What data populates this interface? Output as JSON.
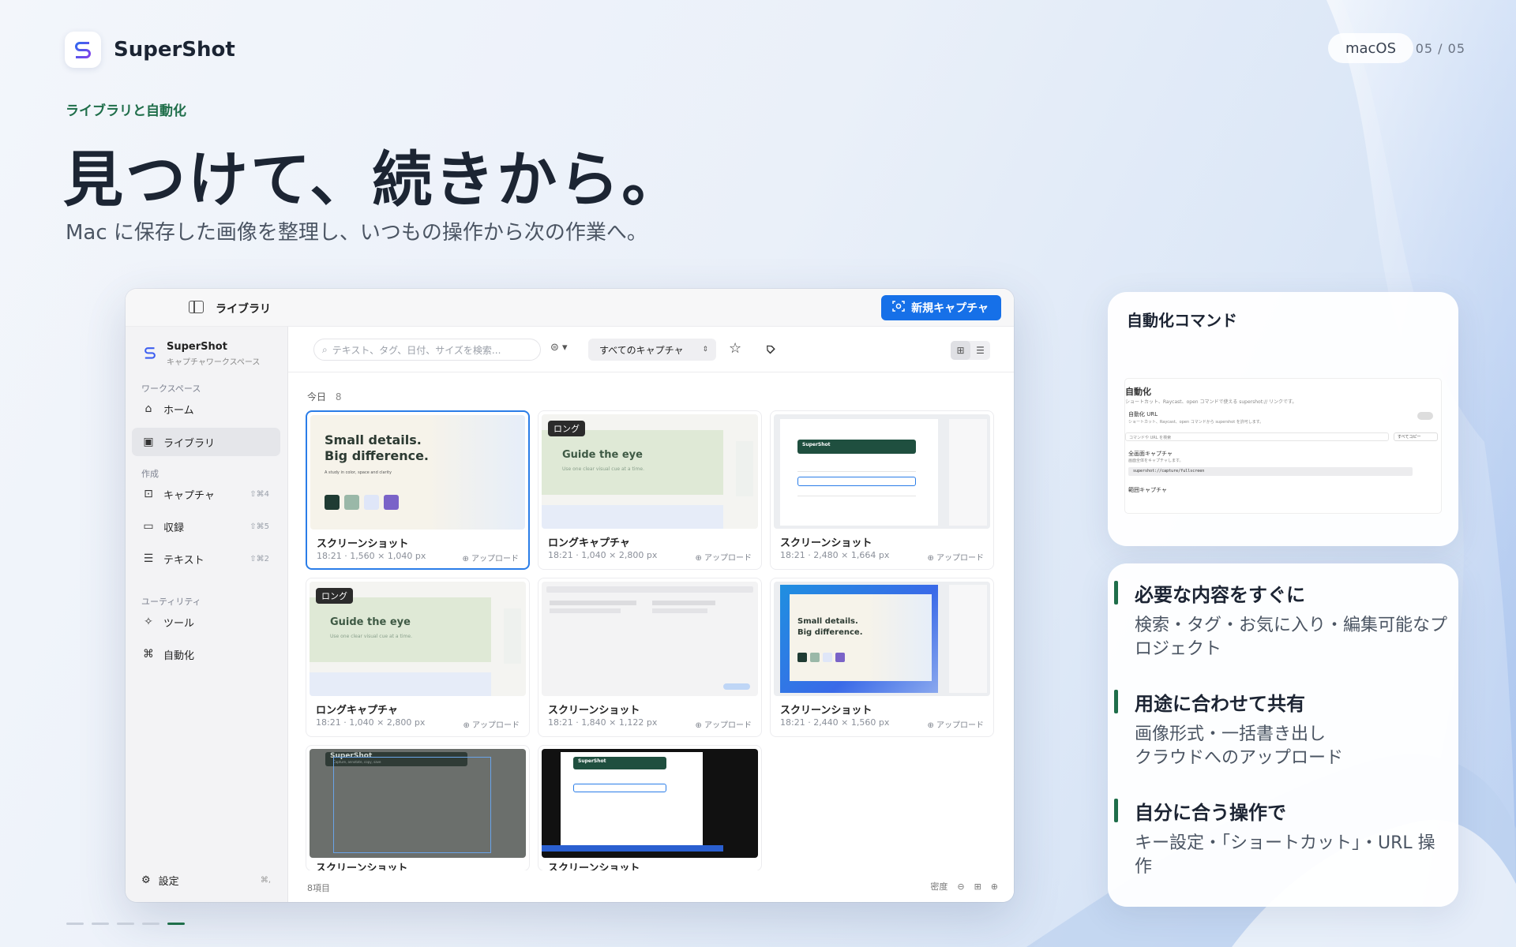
{
  "brand": {
    "name": "SuperShot"
  },
  "platform": "macOS",
  "pager": "05 / 05",
  "hero": {
    "eyebrow": "ライブラリと自動化",
    "headline": "見つけて、続きから。",
    "subline": "Mac に保存した画像を整理し、いつもの操作から次の作業へ。"
  },
  "window": {
    "title": "ライブラリ",
    "new_capture": "新規キャプチャ",
    "workspace": {
      "name": "SuperShot",
      "sub": "キャプチャワークスペース"
    },
    "sections": {
      "workspace": "ワークスペース",
      "create": "作成",
      "utility": "ユーティリティ"
    },
    "nav": {
      "home": "ホーム",
      "library": "ライブラリ",
      "capture": "キャプチャ",
      "capture_key": "⇧⌘4",
      "record": "収録",
      "record_key": "⇧⌘5",
      "text": "テキスト",
      "text_key": "⇧⌘2",
      "tools": "ツール",
      "automation": "自動化"
    },
    "settings": "設定",
    "settings_key": "⌘,",
    "search_placeholder": "テキスト、タグ、日付、サイズを検索...",
    "filter_select": "すべてのキャプチャ",
    "group_label": "今日",
    "group_count": "8",
    "item_count": "8項目",
    "density_label": "密度",
    "cards": [
      {
        "title": "スクリーンショット",
        "meta": "18:21 · 1,560 × 1,040 px",
        "upload": "アップロード",
        "thumb_text_1": "Small details.",
        "thumb_text_2": "Big difference.",
        "thumb_small": "A study in color, space and clarity"
      },
      {
        "title": "ロングキャプチャ",
        "meta": "18:21 · 1,040 × 2,800 px",
        "upload": "アップロード",
        "badge": "ロング",
        "thumb_text_1": "Guide the eye",
        "thumb_small": "Use one clear visual cue at a time."
      },
      {
        "title": "スクリーンショット",
        "meta": "18:21 · 2,480 × 1,664 px",
        "upload": "アップロード",
        "thumb_text_1": "SuperShot"
      },
      {
        "title": "ロングキャプチャ",
        "meta": "18:21 · 1,040 × 2,800 px",
        "upload": "アップロード",
        "badge": "ロング",
        "thumb_text_1": "Guide the eye",
        "thumb_small": "Use one clear visual cue at a time."
      },
      {
        "title": "スクリーンショット",
        "meta": "18:21 · 1,840 × 1,122 px",
        "upload": "アップロード"
      },
      {
        "title": "スクリーンショット",
        "meta": "18:21 · 2,440 × 1,560 px",
        "upload": "アップロード",
        "thumb_text_1": "Small details.",
        "thumb_text_2": "Big difference."
      },
      {
        "title": "スクリーンショット",
        "thumb_text_1": "SuperShot",
        "thumb_small": "Capture, annotate, copy, save"
      },
      {
        "title": "スクリーンショット",
        "thumb_text_1": "SuperShot"
      }
    ]
  },
  "automation_panel": {
    "title": "自動化コマンド",
    "shot_heading": "自動化",
    "shot_line1": "ショートカット、Raycast、open コマンドで使える supershot:// リンクです。",
    "shot_line2": "自動化 URL",
    "shot_line3": "ショートカット、Raycast、open コマンドから supershot を許可します。",
    "shot_search": "コマンドや URL を検索",
    "shot_all": "すべてコピー",
    "shot_line4": "全画面キャプチャ",
    "shot_line5": "画面全体をキャプチャします。",
    "shot_url": "supershot://capture/fullscreen",
    "shot_line6": "範囲キャプチャ"
  },
  "features": [
    {
      "title": "必要な内容をすぐに",
      "desc": "検索・タグ・お気に入り・編集可能なプロジェクト"
    },
    {
      "title": "用途に合わせて共有",
      "desc": "画像形式・一括書き出し\nクラウドへのアップロード"
    },
    {
      "title": "自分に合う操作で",
      "desc": "キー設定・「ショートカット」・URL 操作"
    }
  ],
  "colors": {
    "accent_green": "#1f6e4a",
    "accent_blue": "#1670e8",
    "dark_green": "#1f4f3f"
  }
}
